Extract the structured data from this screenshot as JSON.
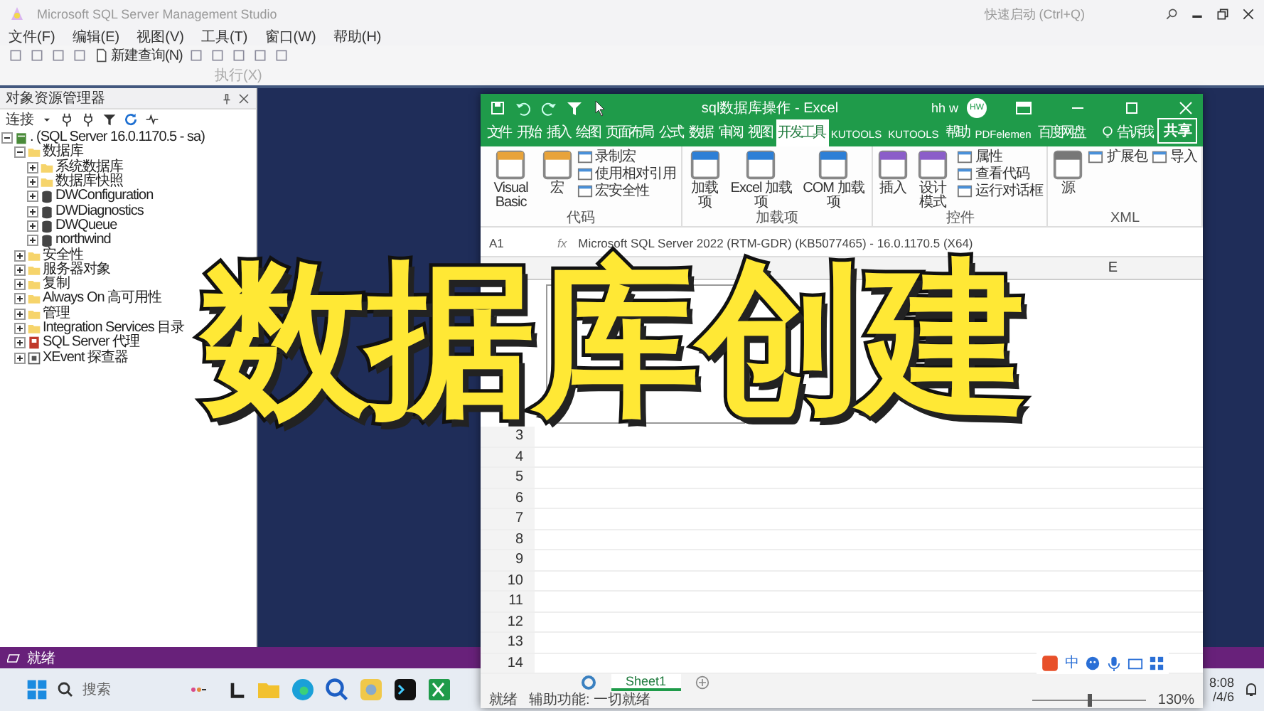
{
  "ssms": {
    "title": "Microsoft SQL Server Management Studio",
    "quick_launch": "快速启动 (Ctrl+Q)",
    "menu": [
      "文件(F)",
      "编辑(E)",
      "视图(V)",
      "工具(T)",
      "窗口(W)",
      "帮助(H)"
    ],
    "new_query": "新建查询(N)",
    "execute": "执行(X)",
    "object_explorer": {
      "title": "对象资源管理器",
      "connect": "连接",
      "tree": [
        {
          "label": ". (SQL Server 16.0.1170.5 - sa)",
          "kind": "server",
          "expanded": true,
          "children": [
            {
              "label": "数据库",
              "kind": "folder",
              "expanded": true,
              "children": [
                {
                  "label": "系统数据库",
                  "kind": "folder",
                  "expanded": false
                },
                {
                  "label": "数据库快照",
                  "kind": "folder",
                  "expanded": false
                },
                {
                  "label": "DWConfiguration",
                  "kind": "database",
                  "expanded": false
                },
                {
                  "label": "DWDiagnostics",
                  "kind": "database",
                  "expanded": false
                },
                {
                  "label": "DWQueue",
                  "kind": "database",
                  "expanded": false
                },
                {
                  "label": "northwind",
                  "kind": "database",
                  "expanded": false
                }
              ]
            },
            {
              "label": "安全性",
              "kind": "folder",
              "expanded": false
            },
            {
              "label": "服务器对象",
              "kind": "folder",
              "expanded": false
            },
            {
              "label": "复制",
              "kind": "folder",
              "expanded": false
            },
            {
              "label": "Always On 高可用性",
              "kind": "folder",
              "expanded": false
            },
            {
              "label": "管理",
              "kind": "folder",
              "expanded": false
            },
            {
              "label": "Integration Services 目录",
              "kind": "folder",
              "expanded": false
            },
            {
              "label": "SQL Server 代理",
              "kind": "agent",
              "expanded": false
            },
            {
              "label": "XEvent 探查器",
              "kind": "xevent",
              "expanded": false
            }
          ]
        }
      ]
    },
    "status": "就绪"
  },
  "excel": {
    "title": "sql数据库操作 - Excel",
    "user": "hh w",
    "avatar": "HW",
    "tabs": [
      {
        "label": "文件",
        "selected": false
      },
      {
        "label": "开始",
        "selected": false
      },
      {
        "label": "插入",
        "selected": false
      },
      {
        "label": "绘图",
        "selected": false
      },
      {
        "label": "页面布局",
        "selected": false
      },
      {
        "label": "公式",
        "selected": false
      },
      {
        "label": "数据",
        "selected": false
      },
      {
        "label": "审阅",
        "selected": false
      },
      {
        "label": "视图",
        "selected": false
      },
      {
        "label": "开发工具",
        "selected": true
      },
      {
        "label": "KUTOOLS",
        "selected": false
      },
      {
        "label": "KUTOOLS",
        "selected": false
      },
      {
        "label": "帮助",
        "selected": false
      },
      {
        "label": "PDFelemen",
        "selected": false
      },
      {
        "label": "百度网盘",
        "selected": false
      }
    ],
    "tell_me": "告诉我",
    "share": "共享",
    "groups": [
      {
        "label": "代码",
        "items": [
          {
            "label": "Visual Basic",
            "kind": "large"
          },
          {
            "label": "宏",
            "kind": "large"
          },
          {
            "kind": "stack",
            "items": [
              "录制宏",
              "使用相对引用",
              "宏安全性"
            ]
          }
        ]
      },
      {
        "label": "加载项",
        "items": [
          {
            "label": "加载项",
            "kind": "large"
          },
          {
            "label": "Excel 加载项",
            "kind": "large"
          },
          {
            "label": "COM 加载项",
            "kind": "large"
          }
        ]
      },
      {
        "label": "控件",
        "items": [
          {
            "label": "插入",
            "kind": "large"
          },
          {
            "label": "设计模式",
            "kind": "large"
          },
          {
            "kind": "stack",
            "items": [
              "属性",
              "查看代码",
              "运行对话框"
            ]
          }
        ]
      },
      {
        "label": "XML",
        "items": [
          {
            "label": "源",
            "kind": "large"
          },
          {
            "kind": "stack",
            "items": [
              "扩展包"
            ]
          },
          {
            "kind": "stack",
            "items": [
              "导入"
            ]
          }
        ]
      }
    ],
    "name_box": "A1",
    "formula": "Microsoft SQL Server 2022 (RTM-GDR) (KB5077465) - 16.0.1170.5 (X64)",
    "column": "E",
    "function_label": "fx",
    "rows": [
      "3",
      "4",
      "5",
      "6",
      "7",
      "8",
      "9",
      "10",
      "11",
      "12",
      "13",
      "14"
    ],
    "ime": "中",
    "sheet": "Sheet1",
    "status": "就绪",
    "accessibility": "辅助功能: 一切就绪",
    "zoom": "130%",
    "zoom_slider": {
      "level": 0.5
    }
  },
  "taskbar": {
    "search": "搜索",
    "time": "8:08",
    "date": "/4/6"
  },
  "overlay_title": "数据库创建"
}
